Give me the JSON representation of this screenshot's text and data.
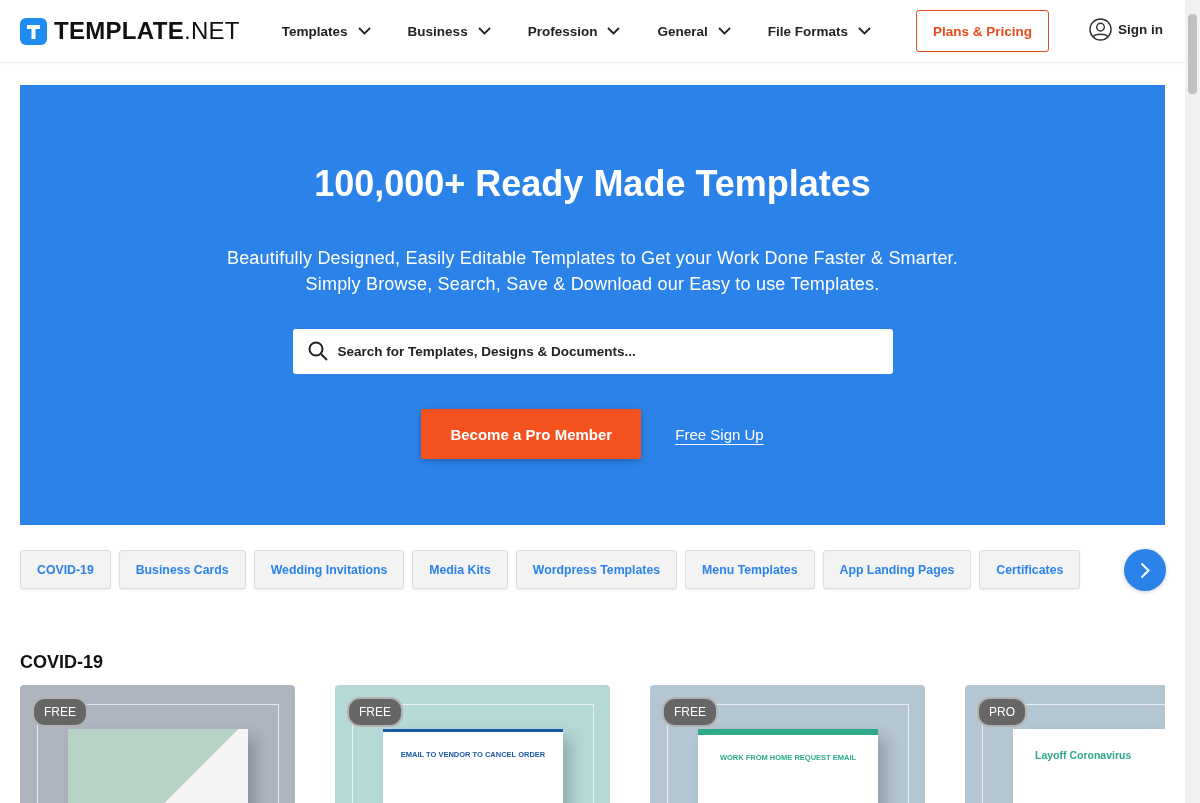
{
  "logo": {
    "brand": "TEMPLATE",
    "suffix": ".NET"
  },
  "nav": [
    {
      "label": "Templates"
    },
    {
      "label": "Business"
    },
    {
      "label": "Profession"
    },
    {
      "label": "General"
    },
    {
      "label": "File Formats"
    }
  ],
  "plans_button": "Plans & Pricing",
  "sign_in": "Sign in",
  "hero": {
    "title": "100,000+ Ready Made Templates",
    "subtitle": [
      "Beautifully Designed, Easily Editable Templates to Get your Work Done Faster & Smarter.",
      "Simply Browse, Search, Save & Download our Easy to use Templates."
    ],
    "search": {
      "placeholder": "Search for Templates, Designs & Documents..."
    },
    "primary_button": "Become a Pro Member",
    "secondary_link": "Free Sign Up"
  },
  "categories": [
    "COVID-19",
    "Business Cards",
    "Wedding Invitations",
    "Media Kits",
    "Wordpress Templates",
    "Menu Templates",
    "App Landing Pages",
    "Certificates"
  ],
  "section": {
    "title": "COVID-19",
    "cards": [
      {
        "badge": "FREE",
        "kind": "diagonal"
      },
      {
        "badge": "FREE",
        "kind": "email",
        "doc_title": "EMAIL TO VENDOR TO CANCEL ORDER"
      },
      {
        "badge": "FREE",
        "kind": "corner",
        "doc_title": "WORK FROM HOME REQUEST EMAIL"
      },
      {
        "badge": "PRO",
        "kind": "plain",
        "doc_title": "Layoff Coronavirus"
      }
    ]
  }
}
